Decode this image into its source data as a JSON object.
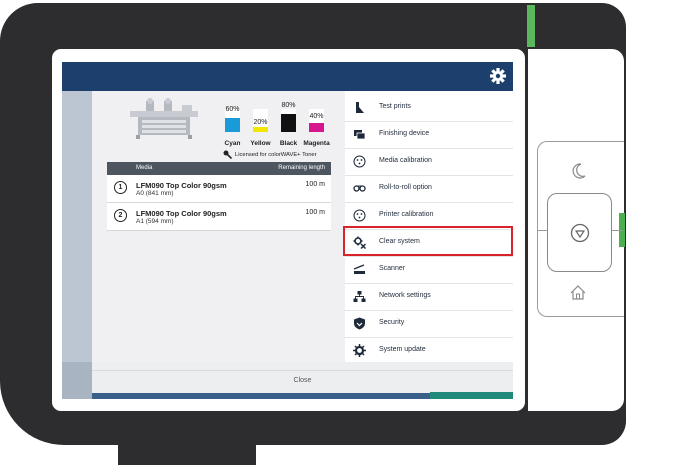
{
  "toners": [
    {
      "name": "Cyan",
      "percent": "60%",
      "level": 0.6,
      "color": "#1a9ad6"
    },
    {
      "name": "Yellow",
      "percent": "20%",
      "level": 0.2,
      "color": "#f3e600"
    },
    {
      "name": "Black",
      "percent": "80%",
      "level": 0.8,
      "color": "#111111"
    },
    {
      "name": "Magenta",
      "percent": "40%",
      "level": 0.4,
      "color": "#d6168c"
    }
  ],
  "licensed_text": "Licensed for colorWAVE+ Toner",
  "media_table": {
    "header_media": "Media",
    "header_length": "Remaining length",
    "rows": [
      {
        "number": "1",
        "name": "LFM090 Top Color 90gsm",
        "size": "A0 (841 mm)",
        "length": "100 m"
      },
      {
        "number": "2",
        "name": "LFM090 Top Color 90gsm",
        "size": "A1 (594 mm)",
        "length": "100 m"
      }
    ]
  },
  "menu": [
    {
      "label": "Test prints",
      "icon": "test-prints-icon"
    },
    {
      "label": "Finishing device",
      "icon": "finishing-device-icon"
    },
    {
      "label": "Media calibration",
      "icon": "media-calibration-icon"
    },
    {
      "label": "Roll-to-roll option",
      "icon": "roll-to-roll-icon"
    },
    {
      "label": "Printer calibration",
      "icon": "printer-calibration-icon"
    },
    {
      "label": "Clear system",
      "icon": "clear-system-icon"
    },
    {
      "label": "Scanner",
      "icon": "scanner-icon"
    },
    {
      "label": "Network settings",
      "icon": "network-settings-icon"
    },
    {
      "label": "Security",
      "icon": "security-icon"
    },
    {
      "label": "System update",
      "icon": "system-update-icon"
    }
  ],
  "highlighted_item": "Clear system",
  "close_label": "Close",
  "colors": {
    "topbar": "#1d3f6e",
    "highlight": "#d8232a",
    "led": "#5cb85c",
    "teal": "#1f8a7a"
  }
}
